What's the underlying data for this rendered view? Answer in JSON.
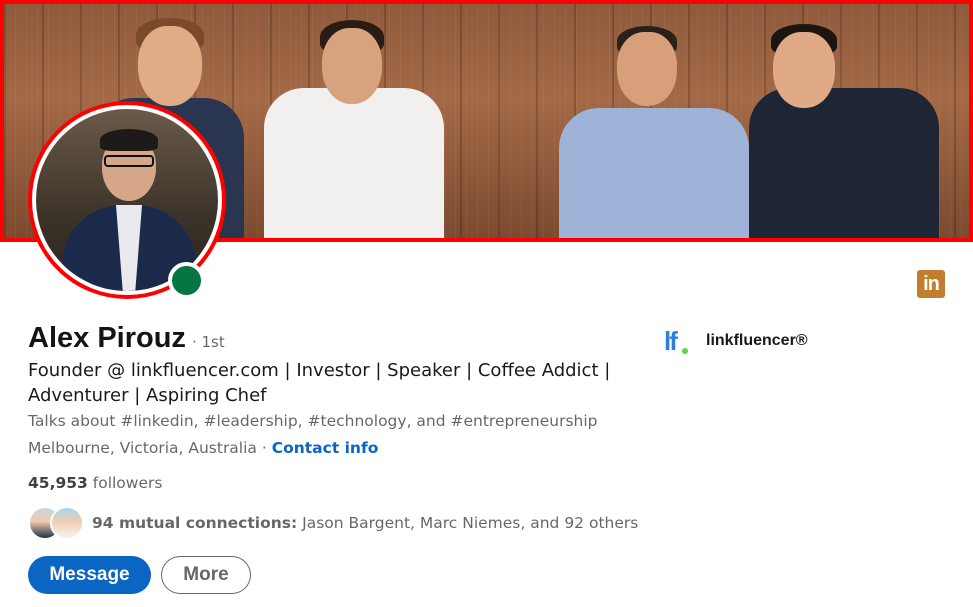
{
  "profile": {
    "name": "Alex Pirouz",
    "degree": "· 1st",
    "headline": "Founder @ linkfluencer.com | Investor | Speaker | Coffee Addict | Adventurer | Aspiring Chef",
    "talks_about": "Talks about #linkedin, #leadership, #technology, and #entrepreneurship",
    "location": "Melbourne, Victoria, Australia",
    "location_separator": " · ",
    "contact_info_label": "Contact info",
    "followers_count": "45,953",
    "followers_label": " followers",
    "mutual_connections_bold": "94 mutual connections:",
    "mutual_connections_names": " Jason Bargent, Marc Niemes, and 92 others",
    "online_status": "online"
  },
  "company": {
    "logo_text": "lf",
    "name": "linkfluencer®"
  },
  "badge": {
    "linkedin_text": "in"
  },
  "actions": {
    "message_label": "Message",
    "more_label": "More"
  },
  "colors": {
    "primary": "#0a66c2",
    "highlight_border": "#ff0000",
    "online": "#057642",
    "linkedin_badge": "#c37d2e"
  },
  "icons": {
    "linkedin_badge": "linkedin-icon",
    "company_logo": "linkfluencer-logo",
    "status": "online-status-icon"
  }
}
